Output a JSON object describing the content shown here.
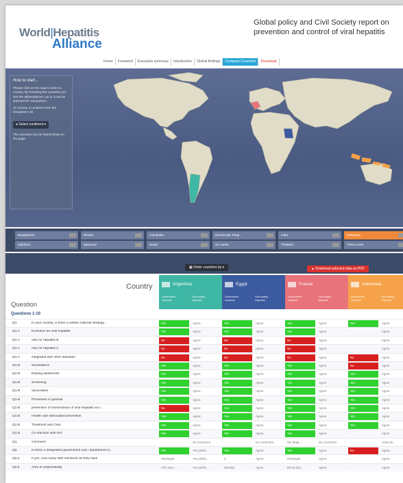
{
  "header": {
    "logo_line1_a": "World",
    "logo_line1_b": "Hepatitis",
    "logo_line2": "Alliance",
    "title_line1": "Global policy and Civil Society report on",
    "title_line2": "prevention and control of viral hepatitis"
  },
  "nav": [
    {
      "label": "Home",
      "active": false
    },
    {
      "label": "Foreword",
      "active": false
    },
    {
      "label": "Executive summary",
      "active": false
    },
    {
      "label": "Introduction",
      "active": false
    },
    {
      "label": "Global findings",
      "active": false
    },
    {
      "label": "Compare Countries",
      "active": true
    },
    {
      "label": "Download",
      "active": false
    }
  ],
  "sidepanel": {
    "title": "How to start...",
    "p1": "Please click on the map to select a country. By hovering the countries you see the abbreviations. Up to 4 can be selected for comparison.",
    "p2": "Or choose a continent from the Dropdown List",
    "button": "Select continent",
    "p3": "The overview can be found below on the page."
  },
  "strip": {
    "row1": [
      "Bangladesh",
      "Bhutan",
      "Cambodia",
      "Democratic Peop...",
      "India",
      "Indonesia"
    ],
    "row2": [
      "Maldives",
      "Myanmar",
      "Nepal",
      "Sri Lanka",
      "Thailand",
      "Timor-Leste"
    ]
  },
  "toolbar": {
    "order_label": "Order countries by",
    "pdf_label": "Download selected data as PDF"
  },
  "table": {
    "country_label": "Country",
    "question_label": "Question",
    "section": "Questions 1-10",
    "gov_label": "Government response",
    "civ_label": "Civil society response",
    "countries": [
      {
        "name": "Argentina",
        "color": "#3fb7a5"
      },
      {
        "name": "Egypt",
        "color": "#3c5aa0"
      },
      {
        "name": "France",
        "color": "#e8737a"
      },
      {
        "name": "Indonesia",
        "color": "#f6a24a"
      }
    ],
    "rows": [
      {
        "num": "Q1.",
        "text": "In your country, is there a written national strategy...",
        "cells": [
          "Yes",
          "Agree",
          "Yes",
          "Agree",
          "Yes",
          "Agree",
          "Yes",
          "Agree"
        ]
      },
      {
        "num": "Q1.A",
        "text": "Exclusive for viral hepatitis",
        "cells": [
          "Yes",
          "Agree",
          "Yes",
          "Agree",
          "Yes",
          "Agree",
          "-",
          "Agree"
        ]
      },
      {
        "num": "Q1.A",
        "text": "only for hepatitis B",
        "cells": [
          "No",
          "Agree",
          "No",
          "Agree",
          "No",
          "Agree",
          "-",
          "Agree"
        ]
      },
      {
        "num": "Q1.A",
        "text": "only for hepatitis C",
        "cells": [
          "No",
          "Agree",
          "No",
          "Agree",
          "No",
          "Agree",
          "-",
          "Agree"
        ]
      },
      {
        "num": "Q1.A",
        "text": "integrated with other diseases",
        "cells": [
          "No",
          "Agree",
          "No",
          "Agree",
          "No",
          "Agree",
          "No",
          "Agree"
        ]
      },
      {
        "num": "Q1.B",
        "text": "Surveillance",
        "cells": [
          "Yes",
          "Agree",
          "Yes",
          "Agree",
          "Yes",
          "Agree",
          "No",
          "Agree"
        ]
      },
      {
        "num": "Q1.B",
        "text": "Raising awareness",
        "cells": [
          "Yes",
          "Agree",
          "Yes",
          "Agree",
          "Yes",
          "Agree",
          "Yes",
          "Agree"
        ]
      },
      {
        "num": "Q1.B",
        "text": "Screening",
        "cells": [
          "Yes",
          "Agree",
          "Yes",
          "Agree",
          "Yes",
          "Agree",
          "Yes",
          "Agree"
        ]
      },
      {
        "num": "Q1.B",
        "text": "Vaccination",
        "cells": [
          "Yes",
          "Agree",
          "Yes",
          "Agree",
          "Yes",
          "Agree",
          "Yes",
          "Agree"
        ]
      },
      {
        "num": "Q1.B",
        "text": "Prevention in general",
        "cells": [
          "Yes",
          "Agree",
          "Yes",
          "Agree",
          "Yes",
          "Agree",
          "Yes",
          "Agree"
        ]
      },
      {
        "num": "Q1.B",
        "text": "prevention of transmission of viral hepatitis via i...",
        "cells": [
          "No",
          "Agree",
          "Yes",
          "Agree",
          "Yes",
          "Agree",
          "Yes",
          "Agree"
        ]
      },
      {
        "num": "Q1.B",
        "text": "Health care associated prevention",
        "cells": [
          "Yes",
          "Agree",
          "Yes",
          "Agree",
          "Yes",
          "Agree",
          "Yes",
          "Agree"
        ]
      },
      {
        "num": "Q1.B",
        "text": "Treatment and Care",
        "cells": [
          "Yes",
          "Agree",
          "Yes",
          "Agree",
          "Yes",
          "Agree",
          "Yes",
          "Agree"
        ]
      },
      {
        "num": "Q1.B",
        "text": "Co-infection with HIV",
        "cells": [
          "Yes",
          "Agree",
          "Yes",
          "Agree",
          "Yes",
          "Agree",
          "-",
          "Agree"
        ]
      },
      {
        "num": "Q1.",
        "text": "Comment",
        "cells": [
          "-",
          "No Comment",
          "-",
          "No Comment",
          "Sie fangt...",
          "No Comment",
          "-",
          "Actar as..."
        ]
      },
      {
        "num": "Q2.",
        "text": "Is there a designated government unit / department re...",
        "cells": [
          "Yes",
          "Yes public...",
          "Yes",
          "Agree",
          "Yes",
          "Agree",
          "No",
          "Agree"
        ]
      },
      {
        "num": "Q2.a",
        "text": "If yes, how many staff members do they have",
        "cells": [
          "Hinyingan",
          "Yes public...",
          "3",
          "Agree",
          "Hinyingan",
          "Agree",
          "-",
          "Agree"
        ]
      },
      {
        "num": "Q2.b",
        "text": "Area of responsibility",
        "cells": [
          "ATP and I...",
          "Yes public...",
          "Monthly",
          "Agree",
          "Blood pub...",
          "Agree",
          "-",
          "Agree"
        ]
      }
    ]
  },
  "colors": {
    "yes": "#2fd12f",
    "no": "#d81f1f",
    "ocean": "#56668c",
    "land": "#e0dcc8",
    "selected_country": "#f3a24a"
  }
}
